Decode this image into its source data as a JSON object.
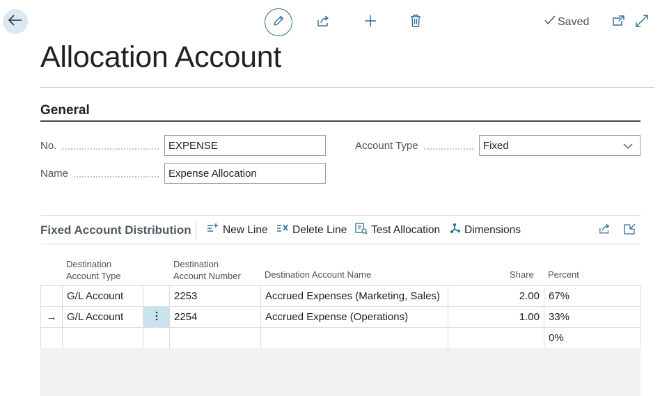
{
  "toolbar": {
    "back_icon": "back-arrow-icon",
    "edit_icon": "pencil-icon",
    "share_icon": "share-icon",
    "new_icon": "plus-icon",
    "delete_icon": "trash-icon",
    "saved_label": "Saved",
    "open_new_window_icon": "open-in-new-window-icon",
    "expand_icon": "expand-icon"
  },
  "page": {
    "title": "Allocation Account"
  },
  "general": {
    "heading": "General",
    "no_label": "No.",
    "no_value": "EXPENSE",
    "name_label": "Name",
    "name_value": "Expense Allocation",
    "account_type_label": "Account Type",
    "account_type_value": "Fixed"
  },
  "distribution": {
    "title": "Fixed Account Distribution",
    "actions": {
      "new_line": "New Line",
      "delete_line": "Delete Line",
      "test_allocation": "Test Allocation",
      "dimensions": "Dimensions"
    },
    "columns": {
      "dest_type_line1": "Destination",
      "dest_type_line2": "Account Type",
      "dest_number_line1": "Destination",
      "dest_number_line2": "Account Number",
      "dest_name": "Destination Account Name",
      "share": "Share",
      "percent": "Percent"
    },
    "rows": [
      {
        "indicator": "",
        "type": "G/L Account",
        "number": "2253",
        "name": "Accrued Expenses (Marketing, Sales)",
        "share": "2.00",
        "percent": "67%"
      },
      {
        "indicator": "→",
        "type": "G/L Account",
        "number": "2254",
        "name": "Accrued Expense (Operations)",
        "share": "1.00",
        "percent": "33%"
      },
      {
        "indicator": "",
        "type": "",
        "number": "",
        "name": "",
        "share": "",
        "percent": "0%"
      }
    ]
  },
  "colors": {
    "accent": "#2e6e93",
    "back_button_bg": "#dbe8f0",
    "selected_cell_bg": "#c9e3ed"
  }
}
